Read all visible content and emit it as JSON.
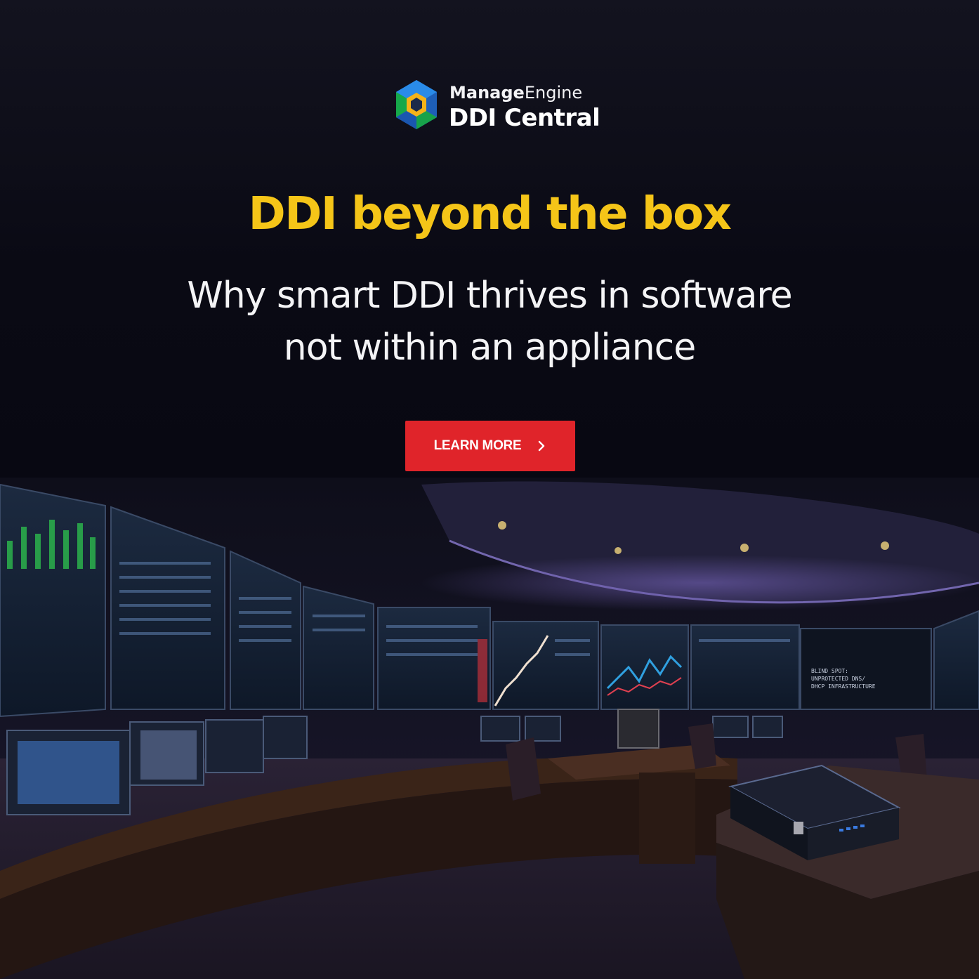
{
  "logo": {
    "brand_light": "Engine",
    "brand_bold": "Manage",
    "product": "DDI Central",
    "icon": "hexagon-cube-logo"
  },
  "headline": "DDI beyond the box",
  "subheadline": {
    "line1": "Why smart DDI thrives in software",
    "line2": "not within an appliance"
  },
  "cta": {
    "label": "LEARN MORE",
    "icon": "chevron-right-icon"
  },
  "scene": {
    "screen_label_line1": "BLIND SPOT:",
    "screen_label_line2": "UNPROTECTED DNS/",
    "screen_label_line3": "DHCP INFRASTRUCTURE"
  },
  "colors": {
    "headline": "#f5c518",
    "cta": "#e0242a",
    "background": "#0b0b16"
  }
}
